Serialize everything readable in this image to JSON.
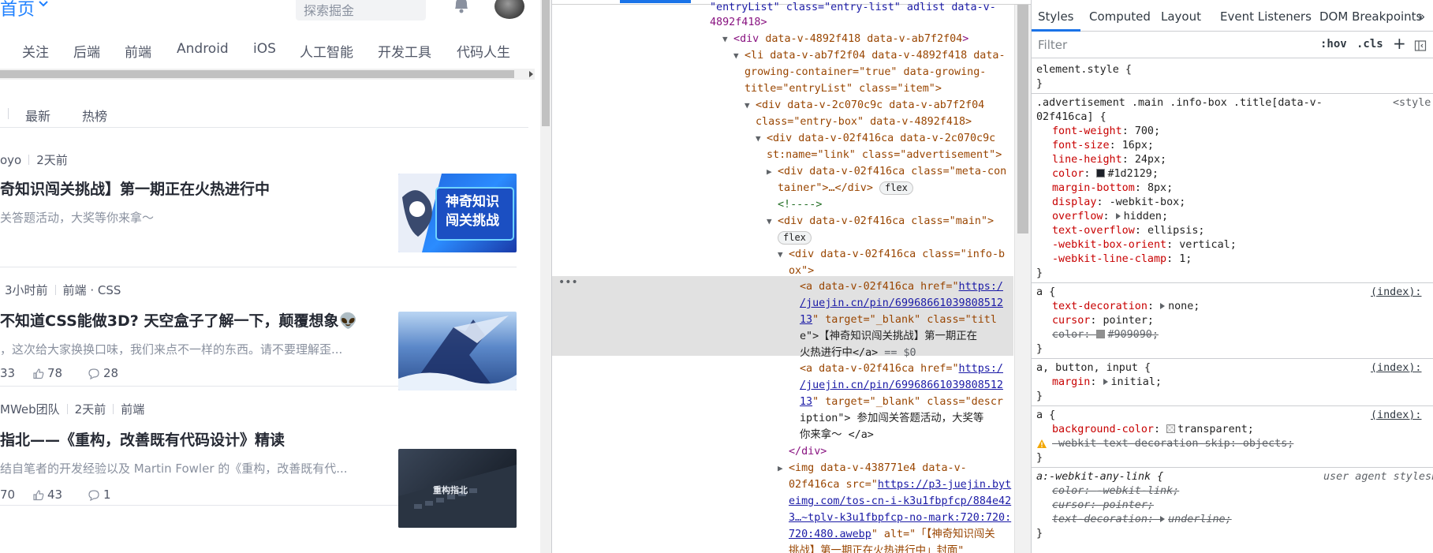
{
  "page": {
    "header": {
      "home_label": "首页",
      "search_placeholder": "探索掘金"
    },
    "categories": [
      "关注",
      "后端",
      "前端",
      "Android",
      "iOS",
      "人工智能",
      "开发工具",
      "代码人生"
    ],
    "sort_tabs": [
      "最新",
      "热榜"
    ],
    "articles": [
      {
        "meta_author": "oyo",
        "meta_time": "2天前",
        "title": "奇知识闯关挑战】第一期正在火热进行中",
        "desc": "关答题活动，大奖等你来拿～",
        "thumb_text": "神奇知识闯关挑战"
      },
      {
        "meta_time": "3小时前",
        "meta_tags": "前端 · CSS",
        "title": "不知道CSS能做3D? 天空盒子了解一下，颠覆想象👽",
        "desc": "，这次给大家换换口味，我们来点不一样的东西。请不要理解歪...",
        "views": "33",
        "likes": "78",
        "comments": "28"
      },
      {
        "meta_author": "MWeb团队",
        "meta_time": "2天前",
        "meta_tags": "前端",
        "title": "指北——《重构，改善既有代码设计》精读",
        "desc": "结自笔者的开发经验以及 Martin Fowler 的《重构，改善既有代...",
        "thumb_text": "重构指北",
        "views": "70",
        "likes": "43",
        "comments": "1"
      }
    ]
  },
  "elements_panel": {
    "line1_text": "\"entryList\" class=\"entry-list\" adlist data-v-",
    "line2_text": "4892f418>",
    "line3": {
      "tag": "div",
      "attrs": "data-v-4892f418 data-v-ab7f2f04"
    },
    "line4a": "<li data-v-ab7f2f04 data-v-4892f418 data-",
    "line4b": "growing-container=\"true\" data-growing-",
    "line4c": "title=\"entryList\" class=\"item\">",
    "line5a": "<div data-v-2c070c9c data-v-ab7f2f04",
    "line5b": "class=\"entry-box\" data-v-4892f418>",
    "line6a": "<div data-v-02f416ca data-v-2c070c9c",
    "line6b": "st:name=\"link\" class=\"advertisement\">",
    "line7a": "<div data-v-02f416ca class=\"meta-con",
    "line7b": "tainer\">…</div>",
    "comment": "<!---->",
    "line9": "<div data-v-02f416ca class=\"main\">",
    "line10a": "<div data-v-02f416ca class=\"info-b",
    "line10b": "ox\">",
    "sel_a1": "<a data-v-02f416ca href=\"",
    "sel_link1": "https:/",
    "sel_link2": "/juejin.cn/pin/69968661039808512",
    "sel_link3": "13",
    "sel_a2": "\" target=\"_blank\" class=\"titl",
    "sel_a3": "e\">【神奇知识闯关挑战】第一期正在",
    "sel_a4": "火热进行中</a>",
    "sel_eq": " == $0",
    "a2_1": "<a data-v-02f416ca href=\"",
    "a2_link1": "https:/",
    "a2_link2": "/juejin.cn/pin/69968661039808512",
    "a2_link3": "13",
    "a2_2": "\" target=\"_blank\" class=\"descr",
    "a2_3": "iption\"> 参加闯关答题活动，大奖等",
    "a2_4": "你来拿～ </a>",
    "close_div": "</div>",
    "img1": "<img data-v-438771e4 data-v-",
    "img2": "02f416ca src=\"",
    "img_link1": "https://p3-juejin.byt",
    "img_link2": "eimg.com/tos-cn-i-k3u1fbpfcp/884e42",
    "img_link3": "3…~tplv-k3u1fbpfcp-no-mark:720:720:",
    "img_link4": "720:480.awebp",
    "img3": "\" alt=\"「【神奇知识闯关",
    "img4": "挑战】第一期正在火热进行中」封面\"",
    "flex_pill": "flex"
  },
  "styles_panel": {
    "tabs": [
      "Styles",
      "Computed",
      "Layout",
      "Event Listeners",
      "DOM Breakpoints",
      "»"
    ],
    "filter_placeholder": "Filter",
    "hov": ":hov",
    "cls": ".cls",
    "plus": "+",
    "element_style": "element.style {",
    "close_brace": "}",
    "rule1_selector_a": ".advertisement .main .info-box .title[data-v-",
    "rule1_selector_b": "02f416ca] {",
    "rule1_source": "<style",
    "rule1_props": [
      {
        "name": "font-weight",
        "value": "700;"
      },
      {
        "name": "font-size",
        "value": "16px;"
      },
      {
        "name": "line-height",
        "value": "24px;"
      },
      {
        "name": "color",
        "value": "#1d2129;",
        "swatch": "#1d2129"
      },
      {
        "name": "margin-bottom",
        "value": "8px;"
      },
      {
        "name": "display",
        "value": "-webkit-box;"
      },
      {
        "name": "overflow",
        "value": "hidden;",
        "expand": true
      },
      {
        "name": "text-overflow",
        "value": "ellipsis;"
      },
      {
        "name": "-webkit-box-orient",
        "value": "vertical;"
      },
      {
        "name": "-webkit-line-clamp",
        "value": "1;"
      }
    ],
    "rule2_selector": "a {",
    "rule2_source": "(index):",
    "rule2_props": [
      {
        "name": "text-decoration",
        "value": "none;",
        "expand": true
      },
      {
        "name": "cursor",
        "value": "pointer;"
      },
      {
        "name": "color",
        "value": "#909090;",
        "swatch": "#909090",
        "struck": true
      }
    ],
    "rule3_selector": "a, button, input {",
    "rule3_source": "(index):",
    "rule3_props": [
      {
        "name": "margin",
        "value": "initial;",
        "expand": true
      }
    ],
    "rule4_selector": "a {",
    "rule4_source": "(index):",
    "rule4_props": [
      {
        "name": "background-color",
        "value": "transparent;",
        "swatch": "transparent"
      },
      {
        "name": "-webkit-text-decoration-skip",
        "value": "objects;",
        "struck": true,
        "warn": true
      }
    ],
    "rule5_selector": "a:-webkit-any-link {",
    "rule5_source": "user agent styleshee",
    "rule5_props": [
      {
        "name": "color",
        "value": "-webkit-link;",
        "struck": true
      },
      {
        "name": "cursor",
        "value": "pointer;",
        "struck": true
      },
      {
        "name": "text-decoration",
        "value": "underline;",
        "struck": true,
        "expand": true
      }
    ]
  }
}
